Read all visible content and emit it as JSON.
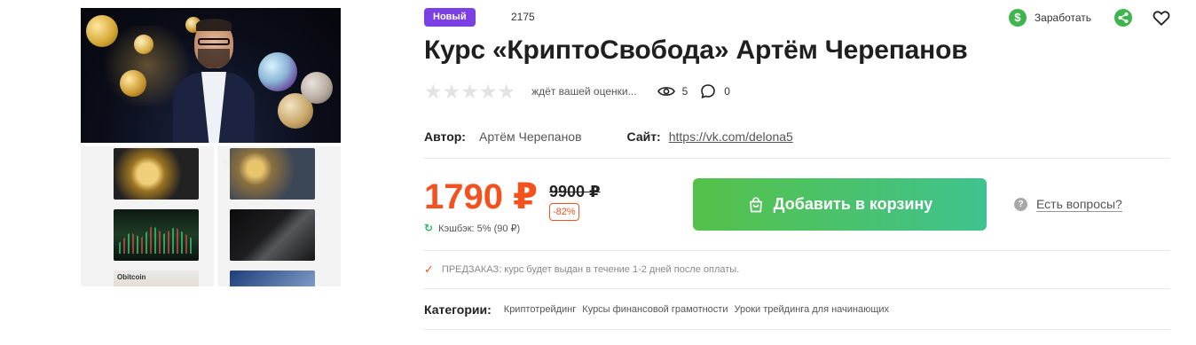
{
  "badge": {
    "label": "Новый"
  },
  "product_id": "2175",
  "actions": {
    "earn_label": "Заработать",
    "earn_icon": "$"
  },
  "title": "Курс «КриптоСвобода» Артём Черепанов",
  "rating": {
    "stars": 5,
    "value": 0,
    "note": "ждёт вашей оценки...",
    "views": "5",
    "comments": "0"
  },
  "meta": {
    "author_label": "Автор:",
    "author_value": "Артём Черепанов",
    "site_label": "Сайт:",
    "site_value": "https://vk.com/delona5"
  },
  "price": {
    "current": "1790 ₽",
    "old": "9900 ₽",
    "discount": "-82%",
    "cashback": "Кэшбэк: 5% (90 ₽)"
  },
  "cart_button": {
    "label": "Добавить в корзину"
  },
  "help": {
    "icon": "?",
    "label": "Есть вопросы?"
  },
  "preorder": "ПРЕДЗАКАЗ: курс будет выдан в течение 1-2 дней после оплаты.",
  "categories": {
    "label": "Категории:",
    "items": [
      "Криптотрейдинг",
      "Курсы финансовой грамотности",
      "Уроки трейдинга для начинающих"
    ]
  },
  "gallery": {
    "thumb_text": "Obitcoin"
  },
  "colors": {
    "badge": "#7b3fe4",
    "price": "#f4511e",
    "button_start": "#55c149",
    "button_end": "#3fc38e",
    "earn": "#3fb54e"
  }
}
